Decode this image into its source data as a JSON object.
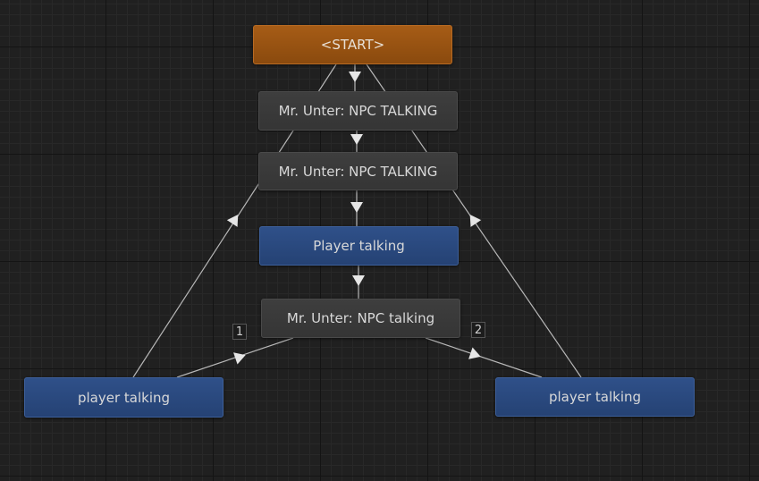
{
  "graph": {
    "nodes": [
      {
        "id": "start",
        "label": "<START>",
        "kind": "start"
      },
      {
        "id": "npc1",
        "label": "Mr. Unter: NPC TALKING",
        "kind": "npc"
      },
      {
        "id": "npc2",
        "label": "Mr. Unter: NPC TALKING",
        "kind": "npc"
      },
      {
        "id": "player1",
        "label": "Player talking",
        "kind": "player"
      },
      {
        "id": "npc3",
        "label": "Mr. Unter: NPC talking",
        "kind": "npc"
      },
      {
        "id": "player_left",
        "label": "player talking",
        "kind": "player"
      },
      {
        "id": "player_right",
        "label": "player talking",
        "kind": "player"
      }
    ],
    "edges": [
      {
        "from": "start",
        "to": "npc1"
      },
      {
        "from": "npc1",
        "to": "npc2"
      },
      {
        "from": "npc2",
        "to": "player1"
      },
      {
        "from": "player1",
        "to": "npc3"
      },
      {
        "from": "npc3",
        "to": "player_left",
        "label": "1"
      },
      {
        "from": "npc3",
        "to": "player_right",
        "label": "2"
      },
      {
        "from": "player_left",
        "to": "start"
      },
      {
        "from": "player_right",
        "to": "start"
      }
    ],
    "colors": {
      "start": "#9a5412",
      "npc": "#3a3a3a",
      "player": "#2a4a80",
      "edge": "#b8b8b8",
      "grid": "#202020"
    }
  }
}
